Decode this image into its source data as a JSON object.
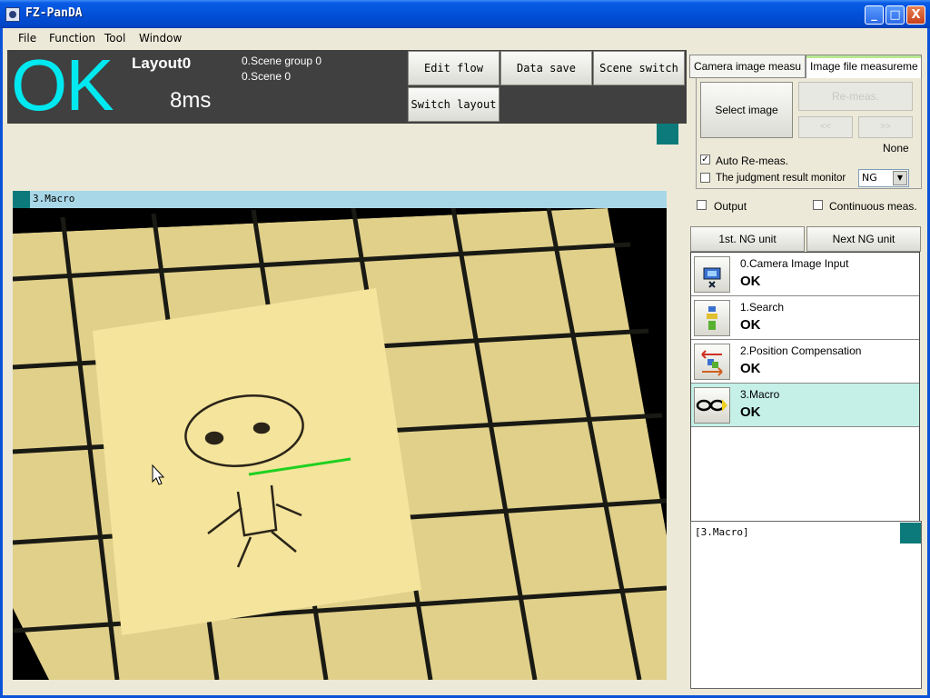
{
  "window": {
    "title": "FZ-PanDA",
    "minimize": "_",
    "maximize": "□",
    "close": "X"
  },
  "menu": {
    "items": [
      "File",
      "Function",
      "Tool",
      "Window"
    ]
  },
  "header": {
    "judgment": "OK",
    "layout": "Layout0",
    "time": "8ms",
    "scene_group": "0.Scene group 0",
    "scene": "0.Scene 0",
    "buttons": {
      "edit_flow": "Edit flow",
      "data_save": "Data save",
      "scene_switch": "Scene switch",
      "switch_layout": "Switch layout"
    },
    "judgment_color": "#00e8f0"
  },
  "image_window": {
    "label": "3.Macro"
  },
  "measure_panel": {
    "tabs": {
      "camera": "Camera image measu",
      "file": "Image file measureme"
    },
    "select_image": "Select image",
    "remeas": "Re-meas.",
    "prev": "<<",
    "next": ">>",
    "file_status": "None",
    "auto_remeas": "Auto Re-meas.",
    "judgment_monitor": "The judgment result monitor",
    "judgment_select": "NG",
    "output": "Output",
    "continuous": "Continuous meas."
  },
  "ng_buttons": {
    "first": "1st. NG unit",
    "next": "Next NG unit"
  },
  "flow": [
    {
      "name": "0.Camera Image Input",
      "result": "OK",
      "icon": "camera-input-icon"
    },
    {
      "name": "1.Search",
      "result": "OK",
      "icon": "search-unit-icon"
    },
    {
      "name": "2.Position Compensation",
      "result": "OK",
      "icon": "position-compensation-icon"
    },
    {
      "name": "3.Macro",
      "result": "OK",
      "icon": "macro-glasses-icon"
    }
  ],
  "detail": {
    "label": "[3.Macro]"
  }
}
